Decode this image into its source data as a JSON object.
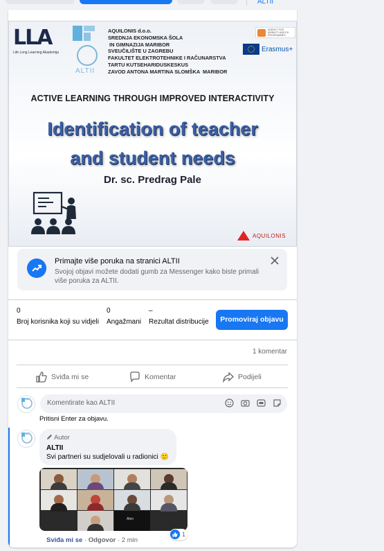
{
  "top": {
    "right_label": "ALTII"
  },
  "post_image": {
    "lla_mark": "LLA",
    "lla_caption": "Life Long Learning Akademija",
    "altii_logo_text": "ALTII",
    "partners_text": "AQUILONIS d.o.o.\nSREDNJA EKONOMSKA ŠOLA\n IN GIMNAZIJA MARIBOR\nSVEUČILIŠTE U ZAGREBU\nFAKULTET ELEKTROTEHNIKE I RAČUNARSTVA\nTARTU KUTSEHARIDUSKESKUS\nZAVOD ANTONA MARTINA SLOMŠKA  MARIBOR",
    "science_logo_text": "AGENCY FOR MOBILITY AND EU PROGRAMMES",
    "erasmus_label": "Erasmus+",
    "header_line": "ACTIVE LEARNING THROUGH IMPROVED INTERACTIVITY",
    "title_line1": "Identification of teacher",
    "title_line2": "and student needs",
    "author": "Dr. sc. Predrag Pale",
    "aquilonis_label": "AQUILONIS"
  },
  "messenger_prompt": {
    "title": "Primajte više poruka na stranici ALTII",
    "text": "Svojoj objavi možete dodati gumb za Messenger kako biste primali više poruka za ALTII."
  },
  "stats": {
    "reach_value": "0",
    "reach_label": "Broj korisnika koji su vidjeli",
    "engagement_value": "0",
    "engagement_label": "Angažmani",
    "distribution_value": "–",
    "distribution_label": "Rezultat distribucije",
    "promote_label": "Promoviraj objavu"
  },
  "comment_count": "1 komentar",
  "actions": {
    "like": "Sviđa mi se",
    "comment": "Komentar",
    "share": "Podijeli"
  },
  "composer": {
    "placeholder": "Komentirate kao ALTII",
    "hint": "Pritisni Enter za objavu."
  },
  "comment": {
    "author_tag": "Autor",
    "name": "ALTII",
    "text": "Svi partneri su sudjelovali u radionici 🙂",
    "reaction_count": "1",
    "like_link": "Sviđa mi se",
    "reply_link": "Odgovor",
    "time": "2 min",
    "attachment_caption": "Alen"
  },
  "colors": {
    "accent": "#1877f2",
    "muted": "#65676b",
    "surface": "#f0f2f5"
  }
}
